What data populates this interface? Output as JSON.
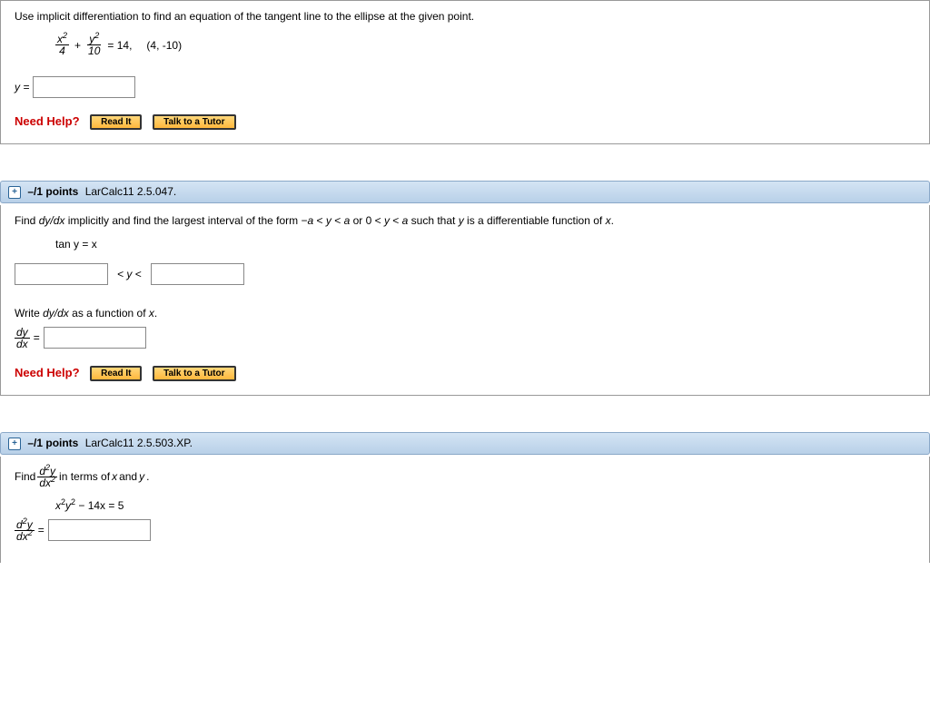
{
  "q1": {
    "instruction": "Use implicit differentiation to find an equation of the tangent line to the ellipse at the given point.",
    "eq_num1_var": "x",
    "eq_num1_pow": "2",
    "eq_den1": "4",
    "plus": "+",
    "eq_num2_var": "y",
    "eq_num2_pow": "2",
    "eq_den2": "10",
    "equals": "= 14,",
    "point": "(4, -10)",
    "y_equals_label": "y =",
    "need_help": "Need Help?",
    "read_it": "Read It",
    "talk_tutor": "Talk to a Tutor"
  },
  "q2": {
    "points": "–/1 points",
    "ref": "LarCalc11 2.5.047.",
    "instruction_a": "Find ",
    "dydx": "dy/dx",
    "instruction_b": " implicitly and find the largest interval of the form  −",
    "a1": "a",
    "lt1": " < ",
    "y1": "y",
    "lt2": " < ",
    "a2": "a",
    "or": "  or  0 < ",
    "y2": "y",
    "lt3": " < ",
    "a3": "a",
    "instruction_c": "  such that ",
    "yvar": "y",
    "instruction_d": " is a differentiable function of ",
    "xvar": "x",
    "period": ".",
    "equation": "tan y = x",
    "between": " < y < ",
    "writeprompt_a": "Write ",
    "writeprompt_b": " as a function of ",
    "frac_dy": "dy",
    "frac_dx": "dx",
    "eq": " = ",
    "need_help": "Need Help?",
    "read_it": "Read It",
    "talk_tutor": "Talk to a Tutor"
  },
  "q3": {
    "points": "–/1 points",
    "ref": "LarCalc11 2.5.503.XP.",
    "find": "Find  ",
    "d2y_num": "d",
    "d2y_pow": "2",
    "d2y_var": "y",
    "d2y_den_d": "d",
    "d2y_den_x": "x",
    "d2y_den_pow": "2",
    "interms": "  in terms of ",
    "xv": "x",
    "and": " and ",
    "yv": "y",
    "period": ".",
    "eq_x": "x",
    "eq_p2a": "2",
    "eq_y": "y",
    "eq_p2b": "2",
    "eq_rest": " − 14x = 5",
    "equals": " = "
  }
}
